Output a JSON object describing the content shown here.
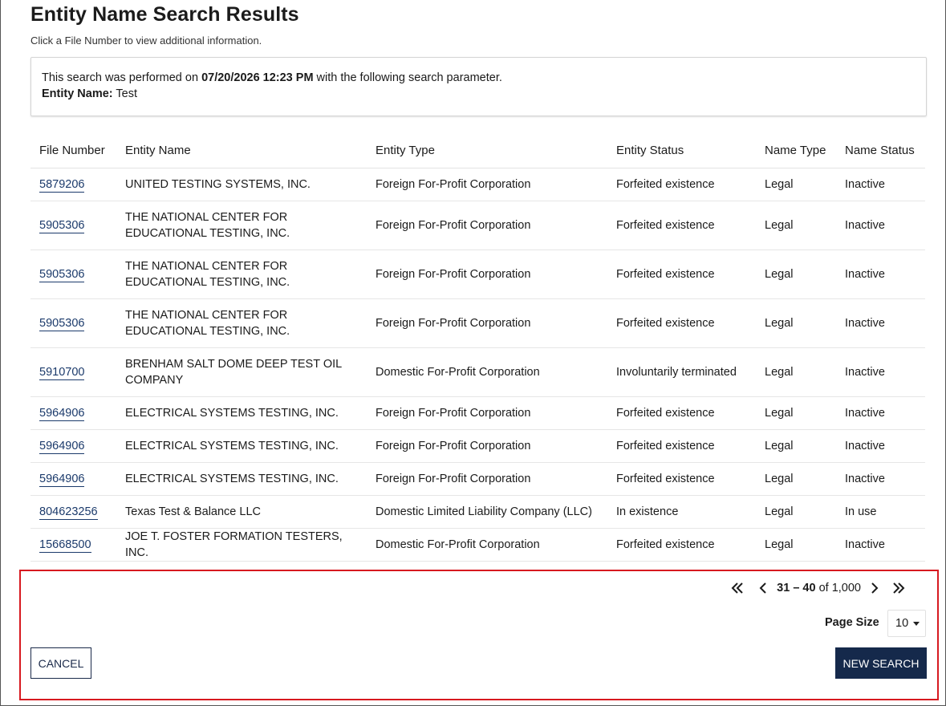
{
  "header": {
    "title": "Entity Name Search Results",
    "subtitle": "Click a File Number to view additional information."
  },
  "search_info": {
    "line1_prefix": "This search was performed on ",
    "datetime": "07/20/2026 12:23 PM",
    "line1_suffix": " with the following search parameter.",
    "param_label": "Entity Name:",
    "param_value": " Test"
  },
  "table": {
    "columns": [
      "File Number",
      "Entity Name",
      "Entity Type",
      "Entity Status",
      "Name Type",
      "Name Status"
    ],
    "rows": [
      [
        "5879206",
        "UNITED TESTING SYSTEMS, INC.",
        "Foreign For-Profit Corporation",
        "Forfeited existence",
        "Legal",
        "Inactive"
      ],
      [
        "5905306",
        "THE NATIONAL CENTER FOR EDUCATIONAL TESTING, INC.",
        "Foreign For-Profit Corporation",
        "Forfeited existence",
        "Legal",
        "Inactive"
      ],
      [
        "5905306",
        "THE NATIONAL CENTER FOR EDUCATIONAL TESTING, INC.",
        "Foreign For-Profit Corporation",
        "Forfeited existence",
        "Legal",
        "Inactive"
      ],
      [
        "5905306",
        "THE NATIONAL CENTER FOR EDUCATIONAL TESTING, INC.",
        "Foreign For-Profit Corporation",
        "Forfeited existence",
        "Legal",
        "Inactive"
      ],
      [
        "5910700",
        "BRENHAM SALT DOME DEEP TEST OIL COMPANY",
        "Domestic For-Profit Corporation",
        "Involuntarily terminated",
        "Legal",
        "Inactive"
      ],
      [
        "5964906",
        "ELECTRICAL SYSTEMS TESTING, INC.",
        "Foreign For-Profit Corporation",
        "Forfeited existence",
        "Legal",
        "Inactive"
      ],
      [
        "5964906",
        "ELECTRICAL SYSTEMS TESTING, INC.",
        "Foreign For-Profit Corporation",
        "Forfeited existence",
        "Legal",
        "Inactive"
      ],
      [
        "5964906",
        "ELECTRICAL SYSTEMS TESTING, INC.",
        "Foreign For-Profit Corporation",
        "Forfeited existence",
        "Legal",
        "Inactive"
      ],
      [
        "804623256",
        "Texas Test & Balance LLC",
        "Domestic Limited Liability Company (LLC)",
        "In existence",
        "Legal",
        "In use"
      ],
      [
        "15668500",
        "JOE T. FOSTER FORMATION TESTERS, INC.",
        "Domestic For-Profit Corporation",
        "Forfeited existence",
        "Legal",
        "Inactive"
      ]
    ]
  },
  "pagination": {
    "range": "31 – 40",
    "of_text": " of 1,000",
    "first_icon": "double-chevron-left-icon",
    "prev_icon": "chevron-left-icon",
    "next_icon": "chevron-right-icon",
    "last_icon": "double-chevron-right-icon"
  },
  "page_size": {
    "label": "Page Size",
    "value": "10"
  },
  "buttons": {
    "cancel": "CANCEL",
    "new_search": "NEW SEARCH"
  },
  "colors": {
    "primary_navy": "#15294b",
    "link": "#1b3a6b",
    "highlight_border": "#d71920"
  }
}
